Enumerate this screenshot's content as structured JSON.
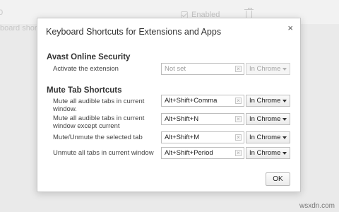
{
  "background": {
    "fragment_top": "0",
    "fragment_left": "board shortcuts",
    "enabled_label": "Enabled"
  },
  "dialog": {
    "title": "Keyboard Shortcuts for Extensions and Apps",
    "close_glyph": "×",
    "ok_label": "OK"
  },
  "sections": [
    {
      "title": "Avast Online Security",
      "rows": [
        {
          "label": "Activate the extension",
          "shortcut": "",
          "placeholder": "Not set",
          "scope": "In Chrome",
          "enabled": false
        }
      ]
    },
    {
      "title": "Mute Tab Shortcuts",
      "rows": [
        {
          "label": "Mute all audible tabs in current window.",
          "shortcut": "Alt+Shift+Comma",
          "scope": "In Chrome",
          "enabled": true
        },
        {
          "label": "Mute all audible tabs in current window except current",
          "shortcut": "Alt+Shift+N",
          "scope": "In Chrome",
          "enabled": true
        },
        {
          "label": "Mute/Unmute the selected tab",
          "shortcut": "Alt+Shift+M",
          "scope": "In Chrome",
          "enabled": true
        },
        {
          "label": "Unmute all tabs in current window",
          "shortcut": "Alt+Shift+Period",
          "scope": "In Chrome",
          "enabled": true
        }
      ]
    }
  ],
  "watermark": "wsxdn.com",
  "icons": {
    "clear": "clear-x-icon",
    "close": "close-icon",
    "dropdown": "chevron-down-icon"
  }
}
